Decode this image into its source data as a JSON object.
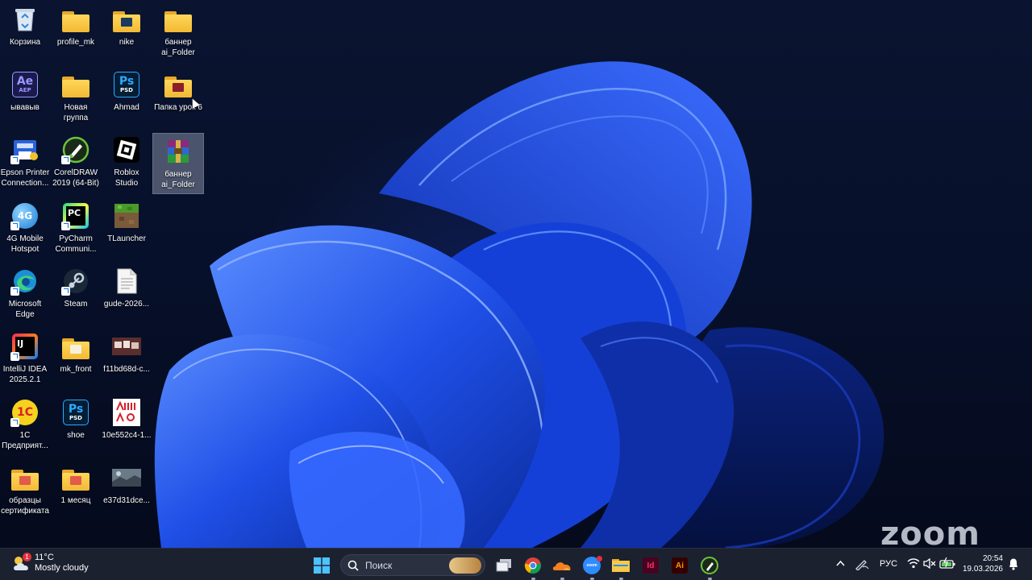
{
  "desktop": {
    "icons": [
      {
        "label": "Корзина",
        "icon": "recycle-bin-icon"
      },
      {
        "label": "profile_mk",
        "icon": "folder-icon"
      },
      {
        "label": "nike",
        "icon": "folder-icon"
      },
      {
        "label": "баннер\nai_Folder",
        "icon": "folder-icon"
      },
      {
        "label": "ывавыв",
        "icon": "after-effects-icon",
        "badge_text": "Ae",
        "sub_text": "AEP"
      },
      {
        "label": "Новая\nгруппа",
        "icon": "folder-icon"
      },
      {
        "label": "Ahmad",
        "icon": "photoshop-icon",
        "badge_text": "Ps",
        "sub_text": "PSD"
      },
      {
        "label": "Папка урок 6",
        "icon": "folder-icon"
      },
      {
        "label": "Epson Printer\nConnection...",
        "icon": "epson-printer-icon"
      },
      {
        "label": "CorelDRAW\n2019 (64-Bit)",
        "icon": "coreldraw-icon"
      },
      {
        "label": "Roblox\nStudio",
        "icon": "roblox-studio-icon"
      },
      {
        "label": "баннер\nai_Folder",
        "icon": "winrar-archive-icon"
      },
      {
        "label": "4G Mobile\nHotspot",
        "icon": "mobile-hotspot-icon",
        "badge_text": "4G"
      },
      {
        "label": "PyCharm\nCommuni...",
        "icon": "pycharm-icon",
        "badge_text": "PC"
      },
      {
        "label": "TLauncher",
        "icon": "tlauncher-icon"
      },
      {
        "label": "Microsoft\nEdge",
        "icon": "edge-icon"
      },
      {
        "label": "Steam",
        "icon": "steam-icon"
      },
      {
        "label": "gude-2026...",
        "icon": "text-document-icon"
      },
      {
        "label": "IntelliJ IDEA\n2025.2.1",
        "icon": "intellij-idea-icon",
        "badge_text": "IJ"
      },
      {
        "label": "mk_front",
        "icon": "folder-icon"
      },
      {
        "label": "f11bd68d-c...",
        "icon": "image-file-icon"
      },
      {
        "label": "1С\nПредприят...",
        "icon": "1c-enterprise-icon",
        "badge_text": "1С"
      },
      {
        "label": "shoe",
        "icon": "photoshop-icon",
        "badge_text": "Ps",
        "sub_text": "PSD"
      },
      {
        "label": "10e552c4-1...",
        "icon": "image-file-icon"
      },
      {
        "label": "образцы\nсертификата",
        "icon": "folder-icon"
      },
      {
        "label": "1 месяц",
        "icon": "folder-icon"
      },
      {
        "label": "e37d31dce...",
        "icon": "image-file-icon"
      }
    ],
    "watermark": "zoom"
  },
  "taskbar": {
    "weather": {
      "temperature": "11°C",
      "condition": "Mostly cloudy",
      "badge": "1"
    },
    "search_placeholder": "Поиск",
    "pinned": [
      {
        "name": "start-button",
        "icon": "windows-logo-icon"
      },
      {
        "name": "task-view-button",
        "icon": "task-view-icon"
      },
      {
        "name": "chrome-button",
        "icon": "chrome-icon"
      },
      {
        "name": "cloudflare-button",
        "icon": "cloud-icon"
      },
      {
        "name": "zoom-button",
        "icon": "zoom-icon"
      },
      {
        "name": "file-explorer-button",
        "icon": "folder-icon"
      },
      {
        "name": "indesign-button",
        "icon": "indesign-icon",
        "badge_text": "Id"
      },
      {
        "name": "illustrator-button",
        "icon": "illustrator-icon",
        "badge_text": "Ai"
      },
      {
        "name": "coreldraw-button",
        "icon": "coreldraw-icon"
      }
    ],
    "tray": {
      "language": "РУС",
      "time": "20:54",
      "date": "19.03.2026"
    }
  },
  "colors": {
    "wallpaper_blue": "#1e5cff",
    "taskbar_bg": "#1c2130",
    "folder_yellow": "#f2b934"
  }
}
